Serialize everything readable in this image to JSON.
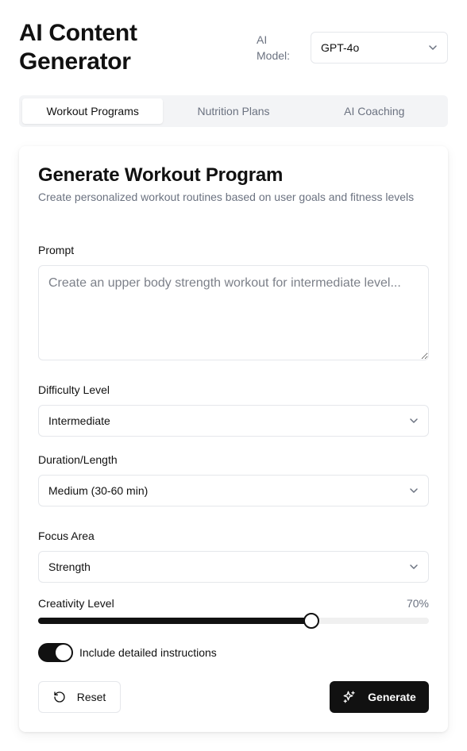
{
  "app": {
    "title": "AI Content Generator",
    "model_label": "AI Model:",
    "model_value": "GPT-4o"
  },
  "tabs": [
    {
      "label": "Workout Programs",
      "active": true
    },
    {
      "label": "Nutrition Plans",
      "active": false
    },
    {
      "label": "AI Coaching",
      "active": false
    }
  ],
  "form": {
    "title": "Generate Workout Program",
    "description": "Create personalized workout routines based on user goals and fitness levels",
    "prompt_label": "Prompt",
    "prompt_placeholder": "Create an upper body strength workout for intermediate level...",
    "prompt_value": "",
    "difficulty_label": "Difficulty Level",
    "difficulty_value": "Intermediate",
    "duration_label": "Duration/Length",
    "duration_value": "Medium (30-60 min)",
    "focus_label": "Focus Area",
    "focus_value": "Strength",
    "creativity_label": "Creativity Level",
    "creativity_display": "70%",
    "creativity_fraction": 0.7,
    "instructions_label": "Include detailed instructions",
    "instructions_enabled": true
  },
  "actions": {
    "reset_label": "Reset",
    "generate_label": "Generate"
  },
  "colors": {
    "primary": "#111111",
    "muted_text": "#6b7280",
    "border": "#e5e7eb",
    "tab_bg": "#f3f4f6"
  },
  "icons": {
    "dropdown": "chevron-down-icon",
    "reset": "rotate-ccw-icon",
    "generate": "sparkles-icon"
  }
}
